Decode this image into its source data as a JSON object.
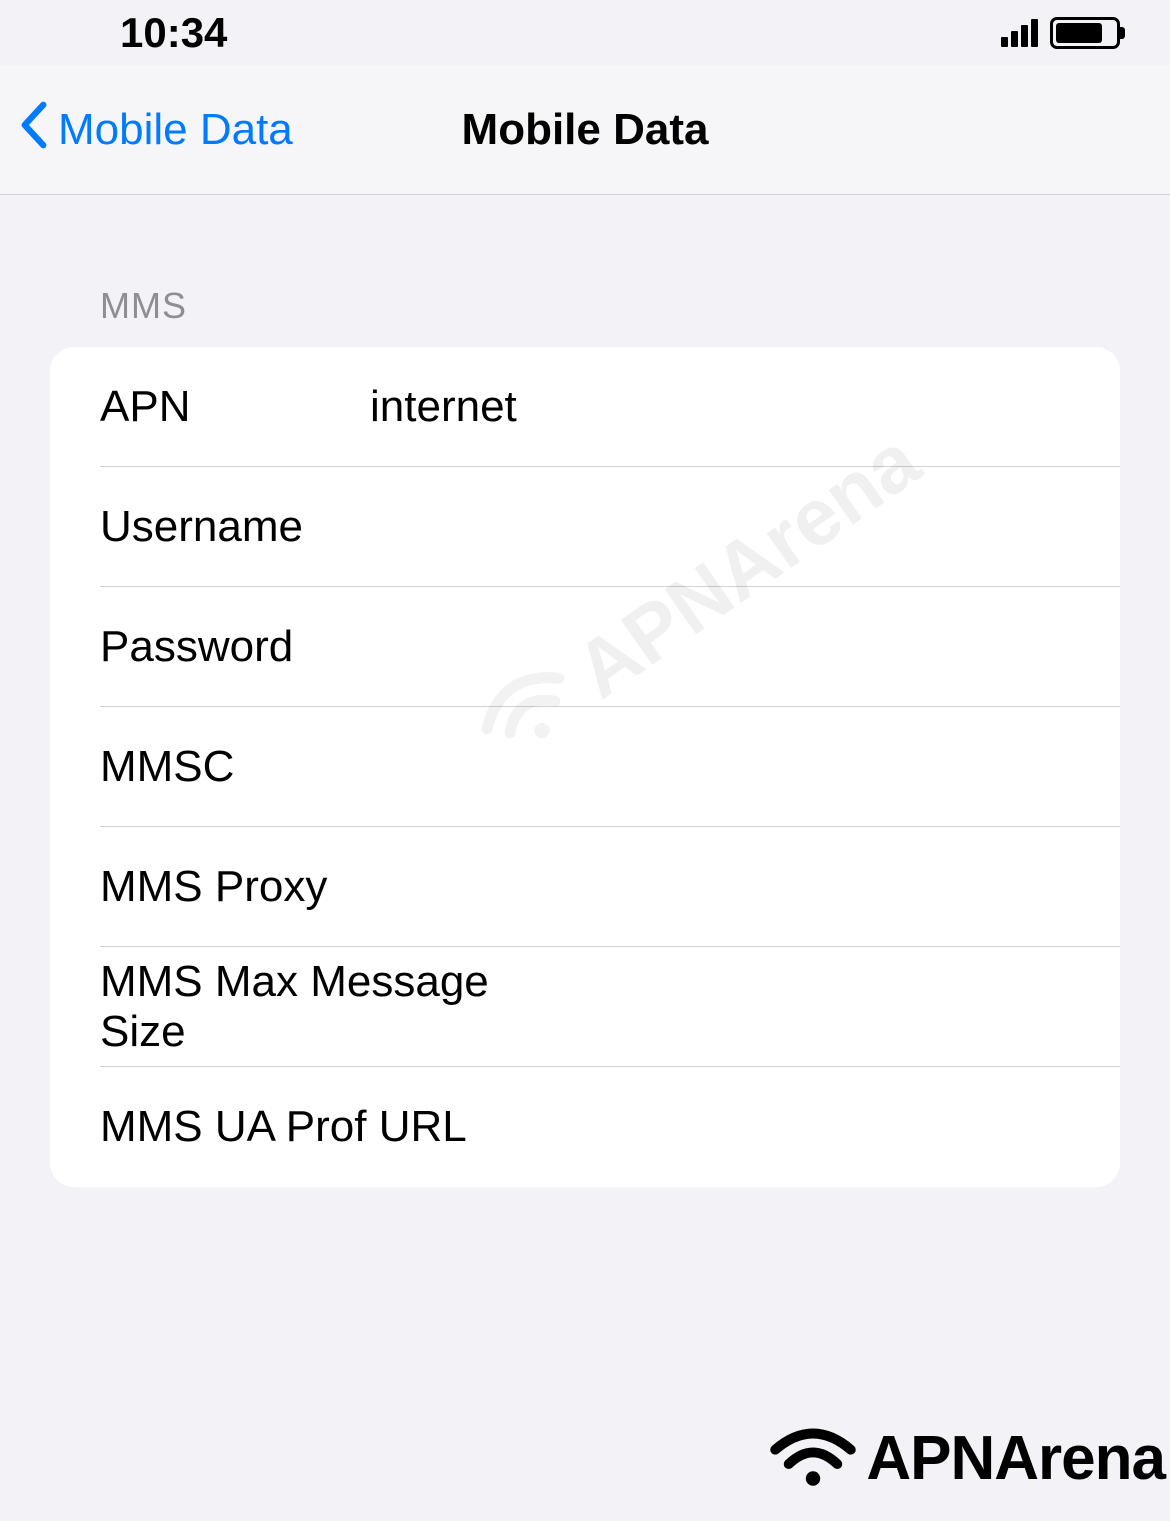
{
  "status_bar": {
    "time": "10:34"
  },
  "nav": {
    "back_label": "Mobile Data",
    "title": "Mobile Data"
  },
  "section": {
    "header": "MMS",
    "rows": [
      {
        "label": "APN",
        "value": "internet"
      },
      {
        "label": "Username",
        "value": ""
      },
      {
        "label": "Password",
        "value": ""
      },
      {
        "label": "MMSC",
        "value": ""
      },
      {
        "label": "MMS Proxy",
        "value": ""
      },
      {
        "label": "MMS Max Message Size",
        "value": ""
      },
      {
        "label": "MMS UA Prof URL",
        "value": ""
      }
    ]
  },
  "watermark": {
    "center": "APNArena",
    "footer": "APNArena"
  }
}
